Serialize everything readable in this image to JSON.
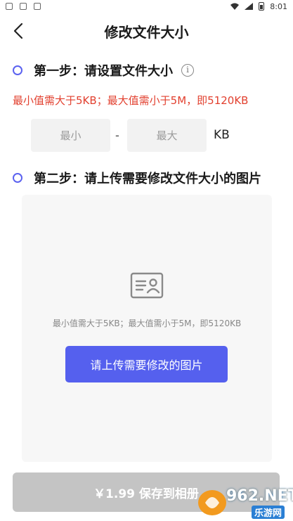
{
  "status_bar": {
    "time": "8:01"
  },
  "nav": {
    "title": "修改文件大小"
  },
  "step1": {
    "label": "第一步：请设置文件大小",
    "warning": "最小值需大于5KB；最大值需小于5M，即5120KB",
    "min_placeholder": "最小",
    "max_placeholder": "最大",
    "separator": "-",
    "unit": "KB"
  },
  "step2": {
    "label": "第二步：请上传需要修改文件大小的图片",
    "hint": "最小值需大于5KB；最大值需小于5M，即5120KB",
    "upload_button": "请上传需要修改的图片"
  },
  "footer": {
    "save_button": "￥1.99 保存到相册"
  },
  "watermark": {
    "brand": "962.NET",
    "subtitle": "乐游网"
  },
  "colors": {
    "accent": "#5560ee",
    "warning": "#e2402f",
    "disabled": "#c4c4c4"
  },
  "icons": [
    "back-arrow-icon",
    "info-icon",
    "id-card-icon",
    "wifi-icon",
    "signal-icon",
    "battery-icon"
  ]
}
